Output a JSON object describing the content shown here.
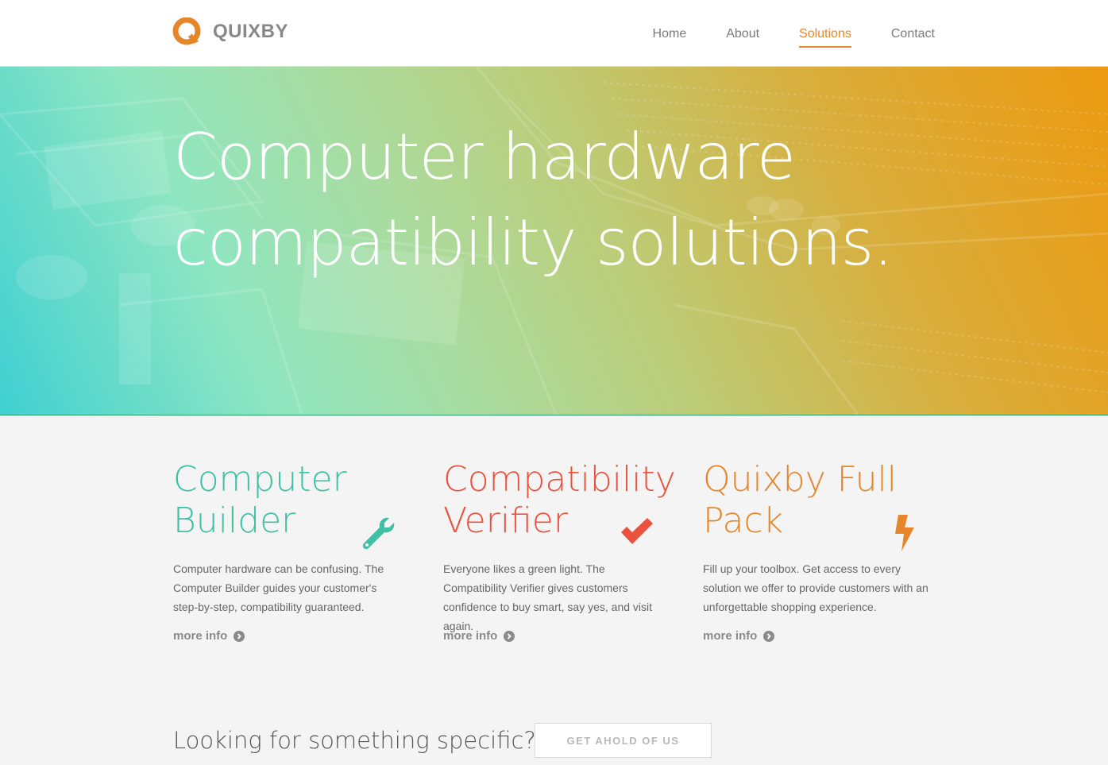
{
  "brand": {
    "name": "QUIXBY",
    "accent": "#e5862a"
  },
  "nav": {
    "items": [
      {
        "label": "Home",
        "active": false
      },
      {
        "label": "About",
        "active": false
      },
      {
        "label": "Solutions",
        "active": true
      },
      {
        "label": "Contact",
        "active": false
      }
    ]
  },
  "hero": {
    "line1": "Computer hardware",
    "line2": "compatibility solutions."
  },
  "features": [
    {
      "title_line1": "Computer",
      "title_line2": "Builder",
      "color": "#3fbfa4",
      "icon": "wrench-icon",
      "body": "Computer hardware can be confusing. The Computer Builder guides your customer's step-by-step, compatibility guaranteed.",
      "more": "more info"
    },
    {
      "title_line1": "Compatibility",
      "title_line2": "Verifier",
      "color": "#e8523f",
      "icon": "checkmark-icon",
      "body": "Everyone likes a green light. The Compatibility Verifier gives customers confidence to buy smart, say yes, and visit again.",
      "more": "more info"
    },
    {
      "title_line1": "Quixby Full",
      "title_line2": "Pack",
      "color": "#e5862a",
      "icon": "lightning-bolt-icon",
      "body": "Fill up your toolbox. Get access to every solution we offer to provide customers with an unforgettable shopping experience.",
      "more": "more info"
    }
  ],
  "cta": {
    "text": "Looking for something specific?",
    "button": "GET AHOLD OF US"
  }
}
